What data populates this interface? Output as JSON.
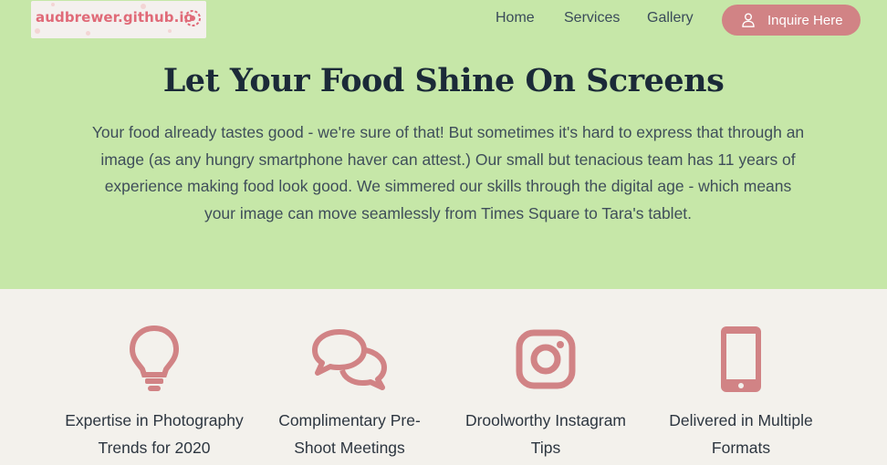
{
  "brand": {
    "logo_text": "audbrewer.github.io",
    "logo_color": "#e06a78"
  },
  "nav": {
    "items": [
      {
        "label": "Home"
      },
      {
        "label": "Services"
      },
      {
        "label": "Gallery"
      }
    ],
    "cta_label": "Inquire Here",
    "cta_icon": "user-icon"
  },
  "hero": {
    "title": "Let Your Food Shine On Screens",
    "body": "Your food already tastes good - we're sure of that! But sometimes it's hard to express that through an image (as any hungry smartphone haver can attest.) Our small but tenacious team has 11 years of experience making food look good. We simmered our skills through the digital age - which means your image can move seamlessly from Times Square to Tara's tablet."
  },
  "features": [
    {
      "icon": "lightbulb-icon",
      "label": "Expertise in Photography Trends for 2020"
    },
    {
      "icon": "chat-bubbles-icon",
      "label": "Complimentary Pre-Shoot Meetings"
    },
    {
      "icon": "instagram-icon",
      "label": "Droolworthy Instagram Tips"
    },
    {
      "icon": "smartphone-icon",
      "label": "Delivered in Multiple Formats"
    }
  ],
  "colors": {
    "hero_bg": "#c6e7a8",
    "page_bg": "#f3f1ec",
    "accent": "#d18385",
    "heading": "#1b2a38"
  }
}
